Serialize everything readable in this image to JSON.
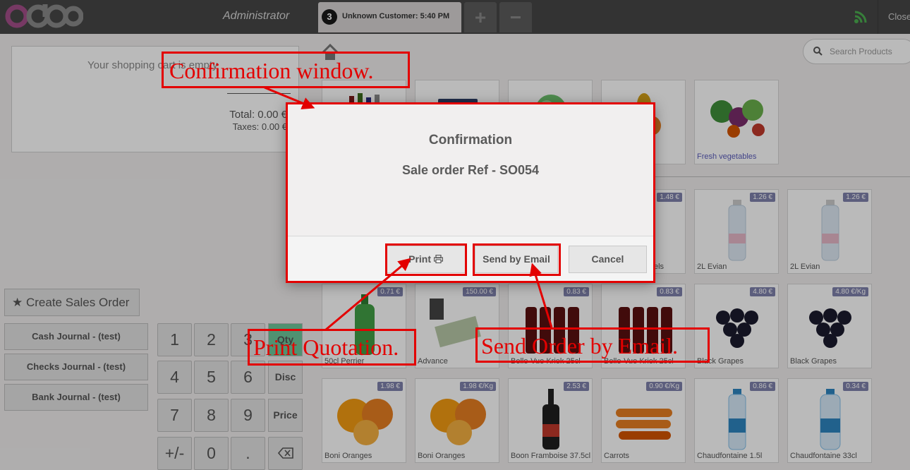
{
  "topbar": {
    "username": "Administrator",
    "order_tab": {
      "number": "3",
      "label": "Unknown Customer: 5:40 PM"
    },
    "add_order_symbol": "+",
    "remove_order_symbol": "−",
    "close_label": "Close"
  },
  "cart": {
    "empty_message": "Your shopping cart is empty",
    "total": "Total: 0.00 €",
    "taxes": "Taxes: 0.00 €"
  },
  "actions": {
    "create_sales_order": "Create Sales Order"
  },
  "journals": [
    "Cash Journal - (test)",
    "Checks Journal - (test)",
    "Bank Journal - (test)"
  ],
  "numpad": {
    "keys": [
      "1",
      "2",
      "3",
      "4",
      "5",
      "6",
      "7",
      "8",
      "9",
      "+/-",
      "0",
      "."
    ],
    "modes": [
      "Qty",
      "Disc",
      "Price"
    ],
    "active_mode": "Qty",
    "backspace_icon": "backspace-icon"
  },
  "search": {
    "placeholder": "Search Products"
  },
  "categories": [
    {
      "name": "",
      "icon": "drinks"
    },
    {
      "name": "",
      "icon": "tablet"
    },
    {
      "name": "",
      "icon": "lettuce"
    },
    {
      "name": "",
      "icon": "fruits"
    },
    {
      "name": "Fresh vegetables",
      "icon": "vegetables"
    }
  ],
  "products": [
    {
      "name": "",
      "price": "",
      "icon": "none"
    },
    {
      "name": "",
      "price": "",
      "icon": "none"
    },
    {
      "name": "",
      "price": "",
      "icon": "none"
    },
    {
      "name": "els",
      "price": "1.48 €",
      "icon": "none"
    },
    {
      "name": "2L Evian",
      "price": "1.26 €",
      "icon": "bottle"
    },
    {
      "name": "2L Evian",
      "price": "1.26 €",
      "icon": "bottle"
    },
    {
      "name": "50cl Perrier",
      "price": "0.71 €",
      "icon": "green-bottle"
    },
    {
      "name": "Advance",
      "price": "150.00 €",
      "icon": "money"
    },
    {
      "name": "Belle-Vue Kriek 25cl",
      "price": "0.83 €",
      "icon": "beer"
    },
    {
      "name": "Belle-Vue Kriek 25cl",
      "price": "0.83 €",
      "icon": "beer"
    },
    {
      "name": "Black Grapes",
      "price": "4.80 €",
      "icon": "grapes"
    },
    {
      "name": "Black Grapes",
      "price": "4.80 €/Kg",
      "icon": "grapes"
    },
    {
      "name": "Boni Oranges",
      "price": "1.98 €",
      "icon": "oranges"
    },
    {
      "name": "Boni Oranges",
      "price": "1.98 €/Kg",
      "icon": "oranges"
    },
    {
      "name": "Boon Framboise 37.5cl",
      "price": "2.53 €",
      "icon": "wine"
    },
    {
      "name": "Carrots",
      "price": "0.90 €/Kg",
      "icon": "carrots"
    },
    {
      "name": "Chaudfontaine 1.5l",
      "price": "0.86 €",
      "icon": "blue-bottle"
    },
    {
      "name": "Chaudfontaine 33cl",
      "price": "0.34 €",
      "icon": "blue-bottle"
    }
  ],
  "dialog": {
    "title": "Confirmation",
    "body": "Sale order Ref - SO054",
    "print_label": "Print",
    "print_icon": "printer-icon",
    "email_label": "Send by Email",
    "cancel_label": "Cancel"
  },
  "annotations": {
    "confirmation": "Confirmation window.",
    "print": "Print Quotation.",
    "email": "Send Order by Email."
  },
  "colors": {
    "annotation": "#e30000",
    "topbar": "#464646",
    "active_mode": "#6ec89b",
    "price_tag": "#7f82ac"
  }
}
